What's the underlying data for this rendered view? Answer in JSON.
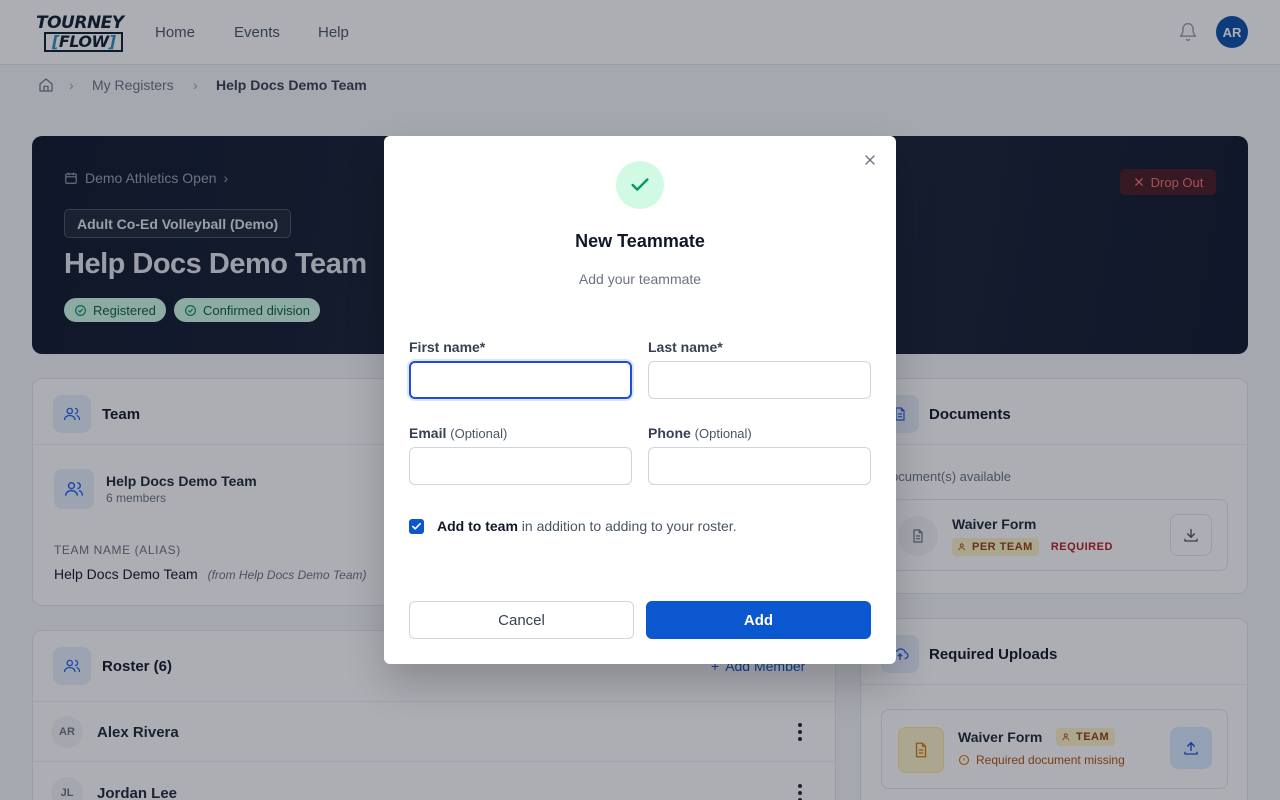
{
  "app": {
    "logo_line1": "TOURNEY",
    "logo_line2": "FLOW",
    "nav": [
      "Home",
      "Events",
      "Help"
    ],
    "user_initials": "AR"
  },
  "breadcrumb": {
    "items": [
      "My Registers",
      "Help Docs Demo Team"
    ]
  },
  "hero": {
    "event": "Demo Athletics Open",
    "division": "Adult Co-Ed Volleyball (Demo)",
    "title": "Help Docs Demo Team",
    "badges": [
      "Registered",
      "Confirmed division"
    ],
    "dropout_label": "Drop Out"
  },
  "team_card": {
    "title": "Team",
    "team_name": "Help Docs Demo Team",
    "members": "6 members",
    "alias_label": "TEAM NAME (ALIAS)",
    "alias_value": "Help Docs Demo Team",
    "alias_from": "(from Help Docs Demo Team)"
  },
  "roster_card": {
    "title": "Roster (6)",
    "add_member_label": "Add Member",
    "members": [
      {
        "initials": "AR",
        "name": "Alex Rivera"
      },
      {
        "initials": "JL",
        "name": "Jordan Lee"
      }
    ]
  },
  "documents_card": {
    "title": "Documents",
    "available": "ocument(s) available",
    "doc_name": "Waiver Form",
    "tag_scope": "PER TEAM",
    "tag_required": "REQUIRED"
  },
  "uploads_card": {
    "title": "Required Uploads",
    "doc_name": "Waiver Form",
    "tag_scope": "TEAM",
    "missing": "Required document missing"
  },
  "modal": {
    "title": "New Teammate",
    "subtitle": "Add your teammate",
    "first_name_label": "First name*",
    "last_name_label": "Last name*",
    "email_label": "Email",
    "phone_label": "Phone",
    "optional": "(Optional)",
    "first_name_value": "",
    "last_name_value": "",
    "email_value": "",
    "phone_value": "",
    "checkbox_checked": true,
    "checkbox_bold": "Add to team",
    "checkbox_rest": " in addition to adding to your roster.",
    "cancel_label": "Cancel",
    "add_label": "Add"
  },
  "colors": {
    "primary": "#0b57d0",
    "success_bg": "#d1fae5",
    "success_fg": "#059669",
    "danger": "#f87171"
  }
}
